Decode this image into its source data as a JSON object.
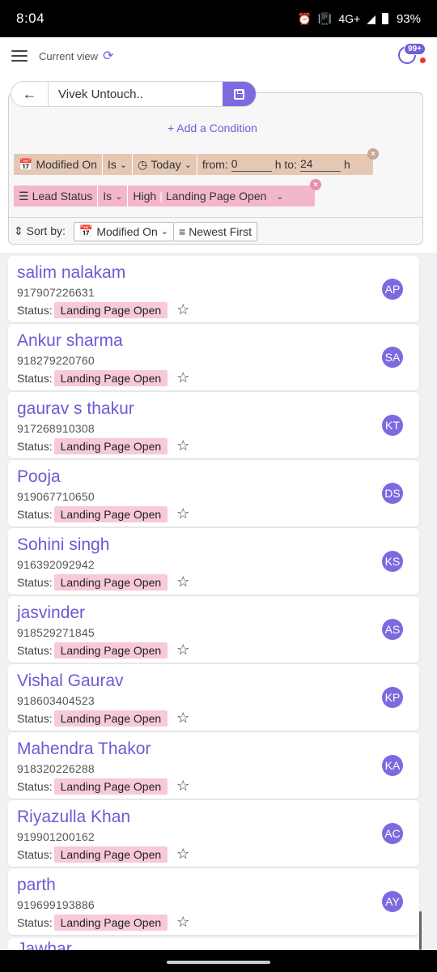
{
  "statusbar": {
    "time": "8:04",
    "network": "4G+",
    "battery": "93%"
  },
  "topbar": {
    "current_view_label": "Current view",
    "notifications_badge": "99+"
  },
  "search": {
    "view_name": "Vivek Untouch.."
  },
  "filters": {
    "add_condition": "+ Add a Condition",
    "row1": {
      "field": "Modified On",
      "operator": "Is",
      "value": "Today",
      "from_label": "from:",
      "from_value": "0",
      "to_label": "h to:",
      "to_value": "24",
      "unit": "h"
    },
    "row2": {
      "field": "Lead Status",
      "operator": "Is",
      "value": "High",
      "value2": "Landing Page Open"
    }
  },
  "sort": {
    "label": "Sort by:",
    "field": "Modified On",
    "order": "Newest First"
  },
  "status_label": "Status:",
  "leads": [
    {
      "name": "salim nalakam",
      "phone": "917907226631",
      "status": "Landing Page Open",
      "avatar": "AP"
    },
    {
      "name": "Ankur sharma",
      "phone": "918279220760",
      "status": "Landing Page Open",
      "avatar": "SA"
    },
    {
      "name": "gaurav s thakur",
      "phone": "917268910308",
      "status": "Landing Page Open",
      "avatar": "KT"
    },
    {
      "name": "Pooja",
      "phone": "919067710650",
      "status": "Landing Page Open",
      "avatar": "DS"
    },
    {
      "name": "Sohini singh",
      "phone": "916392092942",
      "status": "Landing Page Open",
      "avatar": "KS"
    },
    {
      "name": "jasvinder",
      "phone": "918529271845",
      "status": "Landing Page Open",
      "avatar": "AS"
    },
    {
      "name": "Vishal Gaurav",
      "phone": "918603404523",
      "status": "Landing Page Open",
      "avatar": "KP"
    },
    {
      "name": "Mahendra Thakor",
      "phone": "918320226288",
      "status": "Landing Page Open",
      "avatar": "KA"
    },
    {
      "name": "Riyazulla Khan",
      "phone": "919901200162",
      "status": "Landing Page Open",
      "avatar": "AC"
    },
    {
      "name": "parth",
      "phone": "919699193886",
      "status": "Landing Page Open",
      "avatar": "AY"
    }
  ],
  "partial_lead": "Jawhar",
  "colors": {
    "accent": "#7b6ae0",
    "status_pill": "#f7c9da",
    "filter_date": "#e4c8b3",
    "filter_status": "#f3b7cc"
  }
}
